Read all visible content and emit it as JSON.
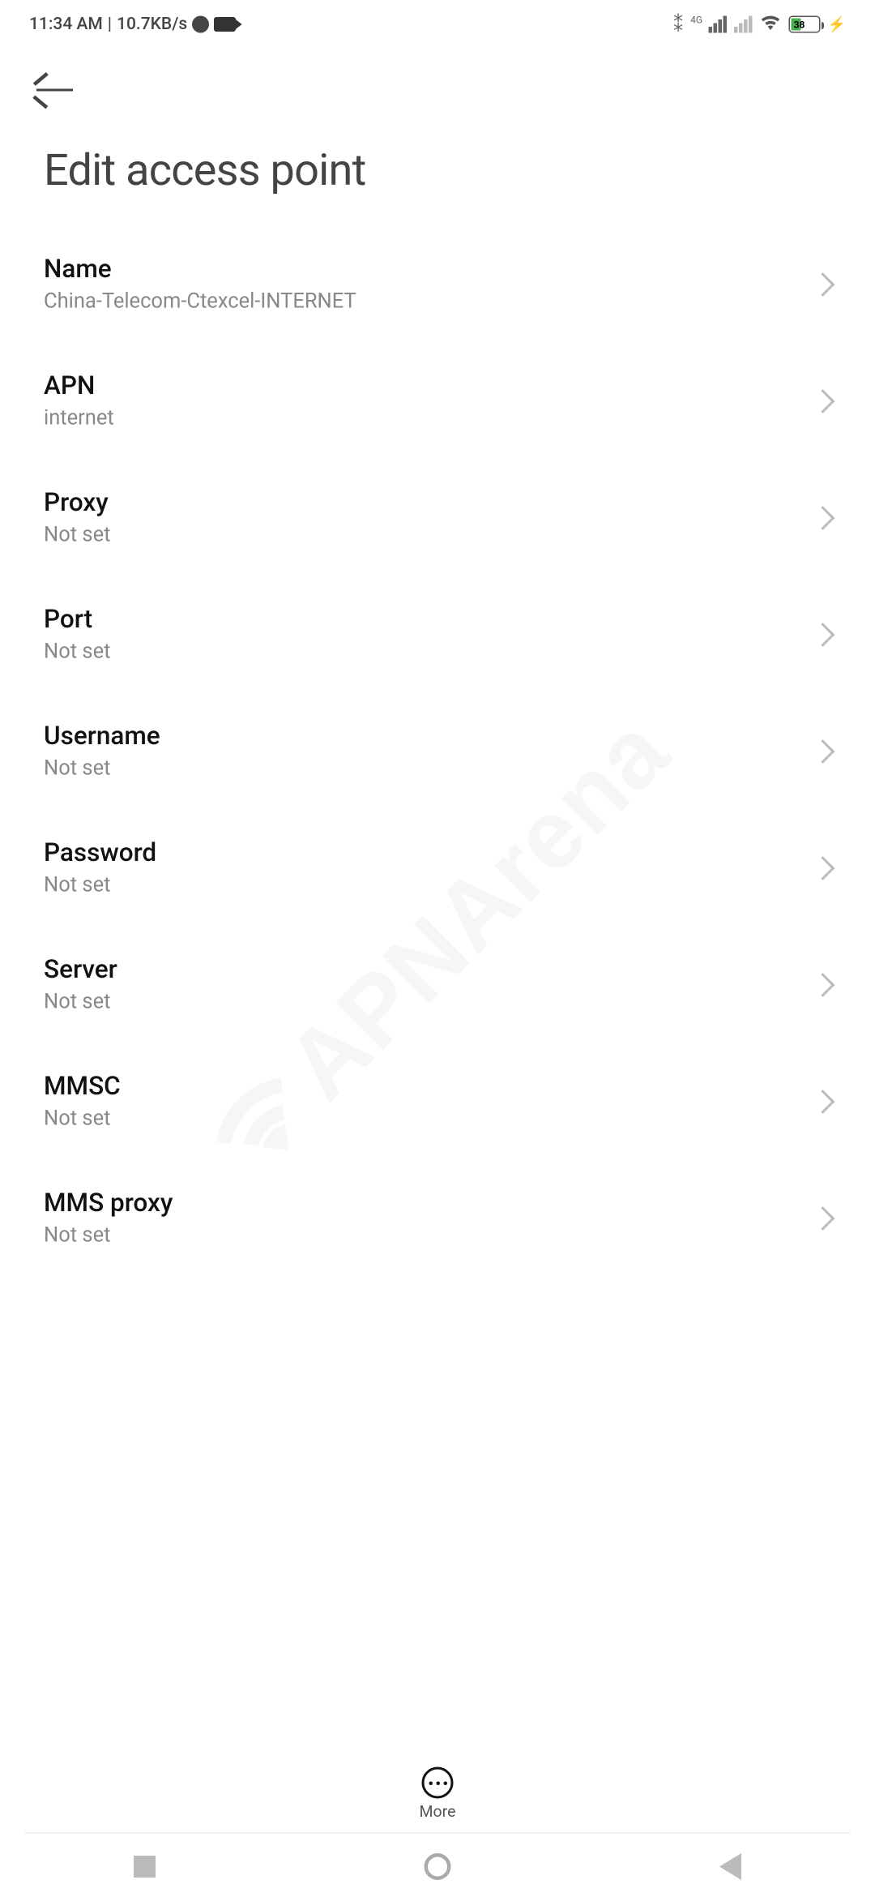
{
  "status_bar": {
    "time": "11:34 AM",
    "net_speed": "10.7KB/s",
    "net_label": "4G",
    "battery_pct": "38"
  },
  "page_title": "Edit access point",
  "settings": [
    {
      "label": "Name",
      "value": "China-Telecom-Ctexcel-INTERNET",
      "name": "name"
    },
    {
      "label": "APN",
      "value": "internet",
      "name": "apn"
    },
    {
      "label": "Proxy",
      "value": "Not set",
      "name": "proxy"
    },
    {
      "label": "Port",
      "value": "Not set",
      "name": "port"
    },
    {
      "label": "Username",
      "value": "Not set",
      "name": "username"
    },
    {
      "label": "Password",
      "value": "Not set",
      "name": "password"
    },
    {
      "label": "Server",
      "value": "Not set",
      "name": "server"
    },
    {
      "label": "MMSC",
      "value": "Not set",
      "name": "mmsc"
    },
    {
      "label": "MMS proxy",
      "value": "Not set",
      "name": "mms-proxy"
    }
  ],
  "more_label": "More",
  "watermark": "APNArena"
}
